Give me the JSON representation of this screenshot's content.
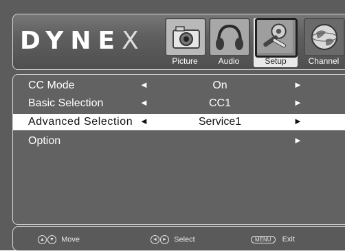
{
  "brand": {
    "logo_main": "DYNE",
    "logo_x": "X"
  },
  "tabs": [
    {
      "label": "Picture",
      "icon": "camera-icon"
    },
    {
      "label": "Audio",
      "icon": "headphones-icon"
    },
    {
      "label": "Setup",
      "icon": "tools-icon",
      "selected": true
    },
    {
      "label": "Channel",
      "icon": "globe-icon"
    }
  ],
  "menu": {
    "rows": [
      {
        "label": "CC Mode",
        "value": "On"
      },
      {
        "label": "Basic Selection",
        "value": "CC1"
      },
      {
        "label": "Advanced Selection",
        "value": "Service1",
        "selected": true
      },
      {
        "label": "Option",
        "value": ""
      }
    ],
    "arrow_left": "◄",
    "arrow_right": "►"
  },
  "footer": {
    "move_label": "Move",
    "select_label": "Select",
    "menu_key": "MENU",
    "exit_label": "Exit"
  },
  "colors": {
    "panel_bg": "#626262",
    "highlight": "#ffffff"
  }
}
